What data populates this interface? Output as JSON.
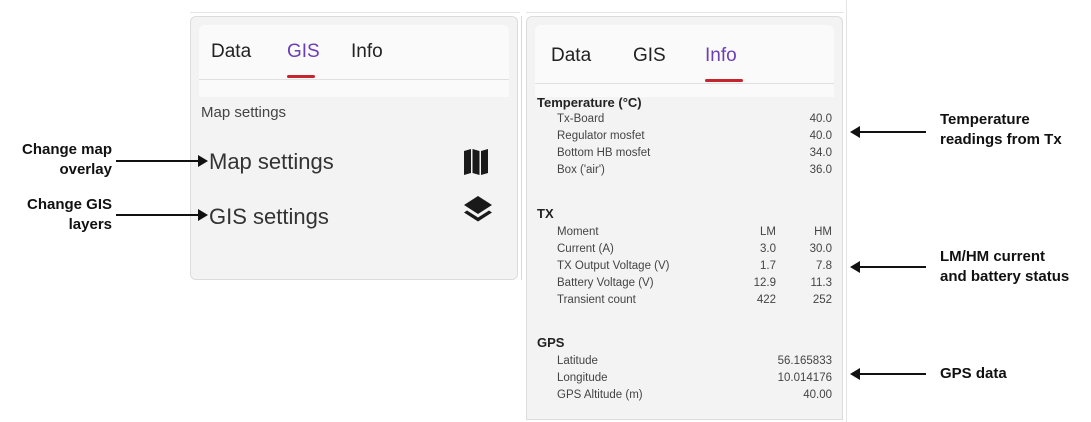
{
  "left_panel": {
    "tabs": [
      {
        "label": "Data"
      },
      {
        "label": "GIS"
      },
      {
        "label": "Info"
      }
    ],
    "active_tab": "GIS",
    "section_label": "Map settings",
    "rows": [
      {
        "label": "Map settings",
        "icon": "map-icon"
      },
      {
        "label": "GIS settings",
        "icon": "layers-icon"
      }
    ]
  },
  "right_panel": {
    "tabs": [
      {
        "label": "Data"
      },
      {
        "label": "GIS"
      },
      {
        "label": "Info"
      }
    ],
    "active_tab": "Info",
    "temperature": {
      "heading": "Temperature (°C)",
      "rows": [
        {
          "label": "Tx-Board",
          "value": "40.0"
        },
        {
          "label": "Regulator mosfet",
          "value": "40.0"
        },
        {
          "label": "Bottom HB mosfet",
          "value": "34.0"
        },
        {
          "label": "Box ('air')",
          "value": "36.0"
        }
      ]
    },
    "tx": {
      "heading": "TX",
      "header_row": {
        "label": "Moment",
        "lm": "LM",
        "hm": "HM"
      },
      "rows": [
        {
          "label": "Current (A)",
          "lm": "3.0",
          "hm": "30.0"
        },
        {
          "label": "TX Output Voltage (V)",
          "lm": "1.7",
          "hm": "7.8"
        },
        {
          "label": "Battery Voltage (V)",
          "lm": "12.9",
          "hm": "11.3"
        },
        {
          "label": "Transient count",
          "lm": "422",
          "hm": "252"
        }
      ]
    },
    "gps": {
      "heading": "GPS",
      "rows": [
        {
          "label": "Latitude",
          "value": "56.165833"
        },
        {
          "label": "Longitude",
          "value": "10.014176"
        },
        {
          "label": "GPS Altitude (m)",
          "value": "40.00"
        }
      ]
    }
  },
  "annotations": {
    "change_map_overlay": [
      "Change map",
      "overlay"
    ],
    "change_gis_layers": [
      "Change GIS",
      "layers"
    ],
    "temperature_readings": [
      "Temperature",
      "readings from Tx"
    ],
    "lm_hm_current": [
      "LM/HM current",
      "and battery status"
    ],
    "gps_data": [
      "GPS data"
    ]
  },
  "colors": {
    "accent_purple": "#6a3fb5",
    "tab_underline": "#c4262e",
    "panel_bg": "#f3f3f3"
  }
}
